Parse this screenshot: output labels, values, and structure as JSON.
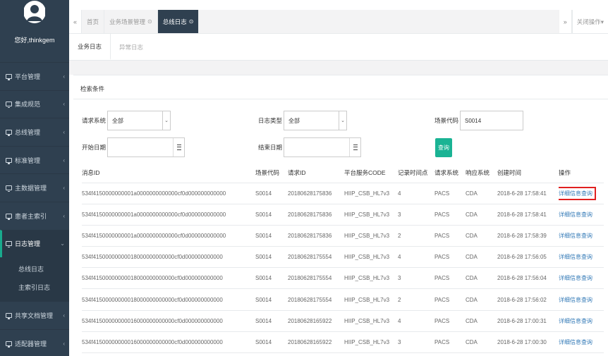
{
  "user": {
    "greeting": "您好,thinkgem"
  },
  "sidebar": {
    "items": [
      {
        "label": "平台管理",
        "arrow": "‹"
      },
      {
        "label": "集成规范",
        "arrow": "‹"
      },
      {
        "label": "总线管理",
        "arrow": "‹"
      },
      {
        "label": "标准管理",
        "arrow": "‹"
      },
      {
        "label": "主数据管理",
        "arrow": "‹"
      },
      {
        "label": "患者主索引",
        "arrow": "‹"
      },
      {
        "label": "日志管理",
        "arrow": "⌄"
      },
      {
        "label": "共享文档管理",
        "arrow": "‹"
      },
      {
        "label": "适配器管理",
        "arrow": "‹"
      }
    ],
    "sub_items": [
      {
        "label": "总线日志"
      },
      {
        "label": "主索引日志"
      }
    ]
  },
  "topbar": {
    "prev": "«",
    "next": "»",
    "tabs": [
      {
        "label": "首页",
        "close": ""
      },
      {
        "label": "业务场景管理",
        "close": "⊙"
      },
      {
        "label": "总线日志",
        "close": "⊙"
      }
    ],
    "close_ops": "关闭操作▾"
  },
  "subtabs": [
    {
      "label": "业务日志"
    },
    {
      "label": "异常日志"
    }
  ],
  "panel": {
    "title": "检索条件"
  },
  "form": {
    "req_system_label": "请求系统",
    "req_system_value": "全部",
    "log_type_label": "日志类型",
    "log_type_value": "全部",
    "scene_code_label": "场景代码",
    "scene_code_value": "S0014",
    "start_date_label": "开始日期",
    "end_date_label": "结束日期",
    "query_label": "查询"
  },
  "table": {
    "headers": [
      "消息ID",
      "场景代码",
      "请求ID",
      "平台服务CODE",
      "记录时间点",
      "请求系统",
      "响应系统",
      "创建时间",
      "操作"
    ],
    "action_label": "详细信息查询",
    "rows": [
      [
        "534f4150000000001a0000000000000cf0d000000000000",
        "S0014",
        "20180628175836",
        "HIIP_CSB_HL7v3",
        "4",
        "PACS",
        "CDA",
        "2018-6-28 17:58:41"
      ],
      [
        "534f4150000000001a0000000000000cf0d000000000000",
        "S0014",
        "20180628175836",
        "HIIP_CSB_HL7v3",
        "3",
        "PACS",
        "CDA",
        "2018-6-28 17:58:41"
      ],
      [
        "534f4150000000001a0000000000000cf0d000000000000",
        "S0014",
        "20180628175836",
        "HIIP_CSB_HL7v3",
        "2",
        "PACS",
        "CDA",
        "2018-6-28 17:58:39"
      ],
      [
        "534f41500000000018000000000000cf0d000000000000",
        "S0014",
        "20180628175554",
        "HIIP_CSB_HL7v3",
        "4",
        "PACS",
        "CDA",
        "2018-6-28 17:56:05"
      ],
      [
        "534f41500000000018000000000000cf0d000000000000",
        "S0014",
        "20180628175554",
        "HIIP_CSB_HL7v3",
        "3",
        "PACS",
        "CDA",
        "2018-6-28 17:56:04"
      ],
      [
        "534f41500000000018000000000000cf0d000000000000",
        "S0014",
        "20180628175554",
        "HIIP_CSB_HL7v3",
        "2",
        "PACS",
        "CDA",
        "2018-6-28 17:56:02"
      ],
      [
        "534f41500000000016000000000000cf0d000000000000",
        "S0014",
        "20180628165922",
        "HIIP_CSB_HL7v3",
        "4",
        "PACS",
        "CDA",
        "2018-6-28 17:00:31"
      ],
      [
        "534f41500000000016000000000000cf0d000000000000",
        "S0014",
        "20180628165922",
        "HIIP_CSB_HL7v3",
        "3",
        "PACS",
        "CDA",
        "2018-6-28 17:00:30"
      ]
    ]
  },
  "colors": {
    "sidebar": "#2f4050",
    "accent": "#1ab394",
    "link": "#337ab7",
    "highlight": "#e02020"
  }
}
